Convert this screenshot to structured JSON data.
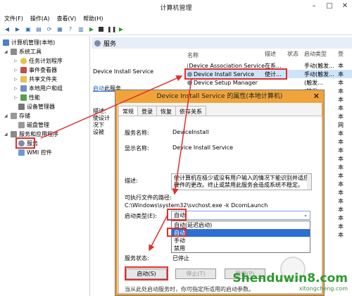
{
  "window": {
    "title": "计算机管理"
  },
  "menu": [
    "文件(F)",
    "操作(A)",
    "查看(V)",
    "帮助(H)"
  ],
  "tree": {
    "root": "计算机管理(本地)",
    "system_tools": "系统工具",
    "task_scheduler": "任务计划程序",
    "event_viewer": "事件查看器",
    "shared_folders": "共享文件夹",
    "local_users": "本地用户和组",
    "performance": "性能",
    "device_manager": "设备管理器",
    "storage": "存储",
    "disk_mgmt": "磁盘管理",
    "services_apps": "服务和应用程序",
    "services": "服务",
    "wmi": "WMI 控件"
  },
  "services_pane": {
    "header": "服务",
    "selected_name": "Device Install Service",
    "start_link": "启动",
    "start_link_rest": "此服务",
    "desc_label": "描述:\n使设计\n况下\n设被"
  },
  "list": {
    "columns": [
      "名称",
      "描述",
      "状态",
      "启动类型",
      "登"
    ],
    "rows": [
      {
        "name": "Device Association Service",
        "desc": "在系...",
        "status": "",
        "startup": "手动(触发...",
        "logon": "本"
      },
      {
        "name": "Device Install Service",
        "desc": "使计...",
        "status": "",
        "startup": "手动(触发...",
        "logon": "本"
      },
      {
        "name": "Device Setup Manager",
        "desc": "",
        "status": "",
        "startup": "(触发...",
        "logon": "本"
      },
      {
        "name": "",
        "desc": "",
        "status": "",
        "startup": "(触发...",
        "logon": "本"
      },
      {
        "name": "",
        "desc": "",
        "status": "",
        "startup": "触发...",
        "logon": "本"
      },
      {
        "name": "",
        "desc": "",
        "status": "",
        "startup": "",
        "logon": "本"
      },
      {
        "name": "",
        "desc": "",
        "status": "",
        "startup": "延迟...",
        "logon": "本"
      },
      {
        "name": "",
        "desc": "",
        "status": "",
        "startup": "",
        "logon": "网"
      },
      {
        "name": "",
        "desc": "",
        "status": "",
        "startup": "",
        "logon": "本"
      },
      {
        "name": "",
        "desc": "",
        "status": "",
        "startup": "",
        "logon": "本"
      },
      {
        "name": "",
        "desc": "",
        "status": "",
        "startup": "(触发...",
        "logon": "本"
      },
      {
        "name": "",
        "desc": "",
        "status": "",
        "startup": "",
        "logon": "本"
      },
      {
        "name": "",
        "desc": "",
        "status": "",
        "startup": "",
        "logon": "本"
      },
      {
        "name": "",
        "desc": "",
        "status": "",
        "startup": "",
        "logon": "本"
      },
      {
        "name": "",
        "desc": "",
        "status": "",
        "startup": "",
        "logon": "本"
      },
      {
        "name": "",
        "desc": "",
        "status": "",
        "startup": "",
        "logon": "本"
      },
      {
        "name": "",
        "desc": "",
        "status": "",
        "startup": "",
        "logon": "本"
      },
      {
        "name": "",
        "desc": "",
        "status": "",
        "startup": "",
        "logon": "本"
      },
      {
        "name": "",
        "desc": "",
        "status": "",
        "startup": "",
        "logon": "本"
      },
      {
        "name": "",
        "desc": "",
        "status": "",
        "startup": "",
        "logon": "本"
      },
      {
        "name": "",
        "desc": "",
        "status": "",
        "startup": "",
        "logon": "本"
      }
    ]
  },
  "dialog": {
    "title": "Device Install Service 的属性(本地计算机)",
    "tabs": [
      "常规",
      "登录",
      "恢复",
      "依存关系"
    ],
    "service_name_label": "服务名称:",
    "service_name": "DeviceInstall",
    "display_name_label": "显示名称:",
    "display_name": "Device Install Service",
    "description_label": "描述:",
    "description": "使计算机在极少或没有用户输入的情况下能识别并适应硬件的更改。终止或禁用此服务会造成系统不稳定。",
    "exe_path_label": "可执行文件的路径:",
    "exe_path": "C:\\Windows\\system32\\svchost.exe -k DcomLaunch",
    "startup_type_label": "启动类型(E):",
    "startup_type_value": "自动",
    "startup_options": [
      "自动(延迟启动)",
      "自动",
      "手动",
      "禁用"
    ],
    "selected_option_index": 1,
    "status_label": "服务状态:",
    "status_value": "已停止",
    "start_button": "启动(S)",
    "stop_button": "停止(T)",
    "pause_button": "暂停(P)",
    "bottom_note": "当从此处启动服务时，你可指定所适用的启动参数。"
  },
  "watermark": {
    "brand": "Shenduwin8.com",
    "sub": "xitongcheng.com"
  },
  "colors": {
    "highlight": "#e03030",
    "dialog_title": "#efa43a",
    "selection": "#2b6fd5",
    "watermark": "#2d9a2d"
  }
}
